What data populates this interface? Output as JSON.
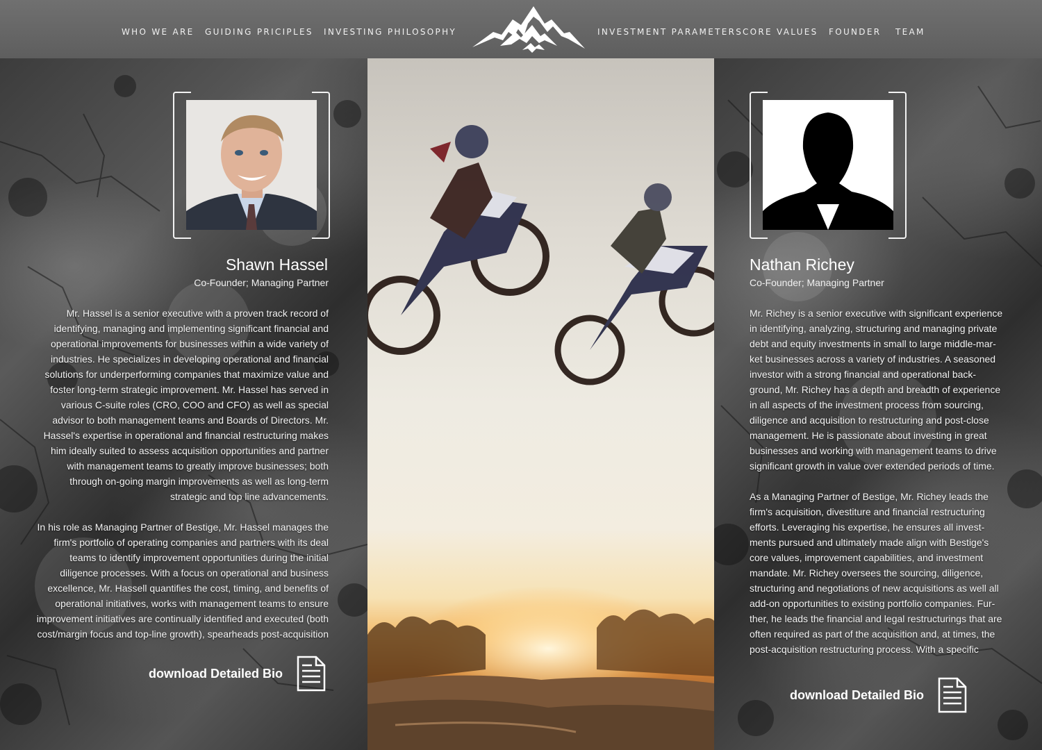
{
  "nav": {
    "items": [
      {
        "label": "WHO WE ARE"
      },
      {
        "label": "GUIDING PRICIPLES"
      },
      {
        "label": "INVESTING PHILOSOPHY"
      },
      {
        "label": "INVESTMENT PARAMETERS"
      },
      {
        "label": "CORE VALUES"
      },
      {
        "label": "FOUNDER"
      },
      {
        "label": "TEAM"
      }
    ],
    "logo_icon": "mountain-logo-icon"
  },
  "colors": {
    "nav_bg": "#666666",
    "text": "#ffffff",
    "sunset": "#f2b764"
  },
  "left_profile": {
    "name": "Shawn Hassel",
    "role": "Co-Founder; Managing Partner",
    "portrait_icon": "headshot-photo",
    "bio": [
      "Mr. Hassel is a senior executive with a proven track record of identifying, managing and implementing significant financial and operational improvements for businesses within a wide variety of industries. He specializes in developing operational and financial solutions for underperforming companies that maximize value and foster long-term strategic improvement.  Mr. Hassel has served in various C-suite roles (CRO, COO and CFO) as well as special advisor to both management teams and Boards of Directors.  Mr. Hassel's expertise in operational and financial restructuring makes him ideally suited to assess acquisition opportunities and partner with management teams to greatly improve businesses; both through on-going margin improvements as well as long-term strategic and top line advancements.",
      "In his role as Managing Partner of Bestige, Mr. Hassel manages the firm's portfolio of operating companies and partners with its deal teams to identify improvement opportunities during the initial diligence processes.  With a focus on operational and business excellence, Mr. Hassell quantifies the cost, timing, and benefits of operational initiatives, works with management teams to ensure improvement initiatives are continually identified and executed (both cost/margin focus and top-line growth), spearheads post-acquisition"
    ],
    "download_label": "download Detailed Bio",
    "download_icon": "document-icon"
  },
  "right_profile": {
    "name": "Nathan Richey",
    "role": "Co-Founder; Managing Partner",
    "portrait_icon": "silhouette-placeholder",
    "bio": [
      "Mr. Richey is a senior executive with significant experience in identifying, analyzing, structuring and managing private debt and equity investments in small to large middle-mar-ket businesses across a variety of industries.  A seasoned investor with a strong financial and operational back-ground, Mr. Richey has a depth and breadth of experience in all aspects of the investment process from sourcing, diligence and acquisition to restructuring and post-close management.  He is passionate about investing in great businesses and working with management teams to drive significant growth in value over extended periods of time.",
      "As a Managing Partner of Bestige, Mr. Richey leads the firm's acquisition, divestiture and financial restructuring efforts. Leveraging his expertise, he ensures all invest-ments pursued and ultimately made align with Bestige's core values, improvement capabilities, and investment mandate.  Mr. Richey oversees the sourcing, diligence, structuring and negotiations of new acquisitions as well all add-on opportunities to existing portfolio companies.  Fur-ther, he leads the financial and legal restructurings that are often required as part of the acquisition and, at times, the post-acquisition restructuring process.  With a specific"
    ],
    "download_label": "download Detailed Bio",
    "download_icon": "document-icon"
  },
  "center_photo": {
    "subject": "motocross-riders-photo"
  }
}
